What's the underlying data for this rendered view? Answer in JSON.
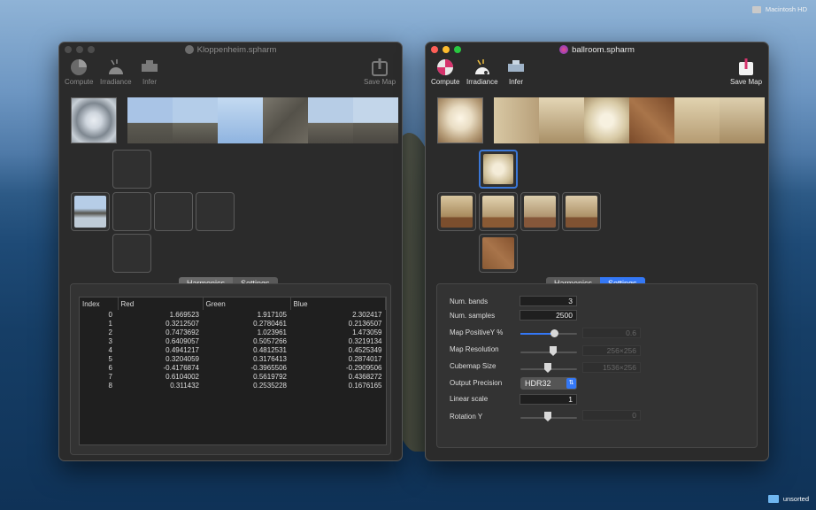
{
  "menubar": {
    "disk_label": "Macintosh HD"
  },
  "desktop": {
    "folder_label": "unsorted"
  },
  "left_window": {
    "title": "Kloppenheim.spharm",
    "toolbar": {
      "compute": "Compute",
      "irradiance": "Irradiance",
      "infer": "Infer",
      "save_map": "Save Map"
    },
    "tabs": {
      "harmonics": "Harmonics",
      "settings": "Settings"
    },
    "table": {
      "headers": [
        "Index",
        "Red",
        "Green",
        "Blue"
      ],
      "rows": [
        [
          "0",
          "1.669523",
          "1.917105",
          "2.302417"
        ],
        [
          "1",
          "0.3212507",
          "0.2780461",
          "0.2136507"
        ],
        [
          "2",
          "0.7473692",
          "1.023961",
          "1.473059"
        ],
        [
          "3",
          "0.6409057",
          "0.5057266",
          "0.3219134"
        ],
        [
          "4",
          "0.4941217",
          "0.4812531",
          "0.4525349"
        ],
        [
          "5",
          "0.3204059",
          "0.3176413",
          "0.2874017"
        ],
        [
          "6",
          "-0.4176874",
          "-0.3965506",
          "-0.2909506"
        ],
        [
          "7",
          "0.6104002",
          "0.5619792",
          "0.4368272"
        ],
        [
          "8",
          "0.311432",
          "0.2535228",
          "0.1676165"
        ]
      ]
    },
    "colors": {
      "sky": "#9bbbe0",
      "rock": "#6a675f"
    }
  },
  "right_window": {
    "title": "ballroom.spharm",
    "toolbar": {
      "compute": "Compute",
      "irradiance": "Irradiance",
      "infer": "Infer",
      "save_map": "Save Map"
    },
    "tabs": {
      "harmonics": "Harmonics",
      "settings": "Settings"
    },
    "settings": {
      "num_bands": {
        "label": "Num. bands",
        "value": "3"
      },
      "num_samples": {
        "label": "Num. samples",
        "value": "2500"
      },
      "map_positive_y": {
        "label": "Map PositiveY %",
        "value": "0.6",
        "slider": 0.6
      },
      "map_resolution": {
        "label": "Map Resolution",
        "value": "256×256"
      },
      "cubemap_size": {
        "label": "Cubemap Size",
        "value": "1536×256"
      },
      "output_precision": {
        "label": "Output Precision",
        "value": "HDR32"
      },
      "linear_scale": {
        "label": "Linear scale",
        "value": "1"
      },
      "rotation_y": {
        "label": "Rotation Y",
        "value": "0"
      }
    },
    "colors": {
      "accent": "#3478f6",
      "wall": "#c9b58a",
      "floor": "#8a5a34"
    }
  }
}
